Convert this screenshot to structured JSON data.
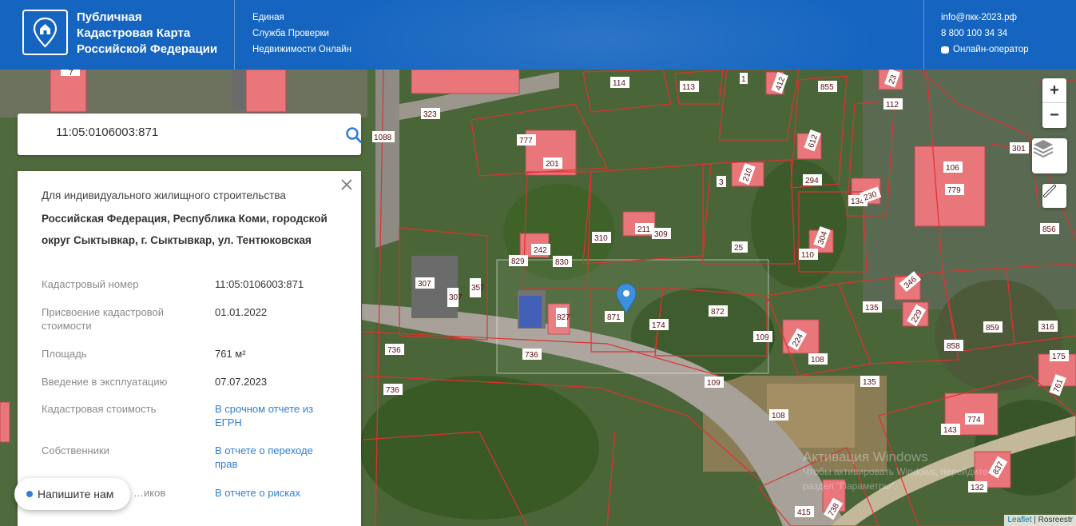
{
  "header": {
    "brand_line1": "Публичная",
    "brand_line2": "Кадастровая Карта",
    "brand_line3": "Российской Федерации",
    "service_line1": "Единая",
    "service_line2": "Служба Проверки",
    "service_line3": "Недвижимости Онлайн",
    "email": "info@пкк-2023.рф",
    "phone": "8 800 100 34 34",
    "operator": "Онлайн-оператор"
  },
  "search": {
    "value": "11:05:0106003:871"
  },
  "panel": {
    "use_type": "Для индивидуального жилищного строительства",
    "address": "Российская Федерация, Республика Коми, городской округ Сыктывкар, г. Сыктывкар, ул. Тентюковская",
    "rows": [
      {
        "label": "Кадастровый номер",
        "value": "11:05:0106003:871"
      },
      {
        "label": "Присвоение кадастровой стоимости",
        "value": "01.01.2022"
      },
      {
        "label": "Площадь",
        "value": "761 м²"
      },
      {
        "label": "Введение в эксплуатацию",
        "value": "07.07.2023"
      },
      {
        "label": "Кадастровая стоимость",
        "value": "В срочном отчете из ЕГРН"
      },
      {
        "label": "Собственники",
        "value": "В отчете о переходе прав"
      },
      {
        "label": "…иков",
        "value": "В отчете о рисках"
      }
    ]
  },
  "chat": {
    "label": "Напишите нам"
  },
  "map": {
    "zoom_in": "+",
    "zoom_out": "−",
    "attribution_leaflet": "Leaflet",
    "attribution_sep": " | ",
    "attribution_source": "Rosreestr",
    "watermark_line1": "Активация Windows",
    "watermark_line2": "Чтобы активировать Windows, перейдите в",
    "watermark_line3": "раздел \"Параметры\".",
    "plot_numbers": [
      "114",
      "113",
      "1",
      "412",
      "855",
      "112",
      "323",
      "1088",
      "777",
      "201",
      "210",
      "3",
      "612",
      "294",
      "230",
      "134",
      "106",
      "779",
      "301",
      "856",
      "310",
      "211",
      "309",
      "25",
      "304",
      "110",
      "829",
      "242",
      "830",
      "307",
      "357",
      "827",
      "871",
      "174",
      "872",
      "109",
      "346",
      "135",
      "229",
      "316",
      "175",
      "859",
      "858",
      "224",
      "108",
      "736",
      "736",
      "736",
      "109",
      "135",
      "108",
      "774",
      "143",
      "761",
      "837",
      "132",
      "415",
      "738"
    ],
    "pin_color": "#3d8fe0",
    "plot_outline": "#e03030",
    "building_color": "#e8767a"
  }
}
